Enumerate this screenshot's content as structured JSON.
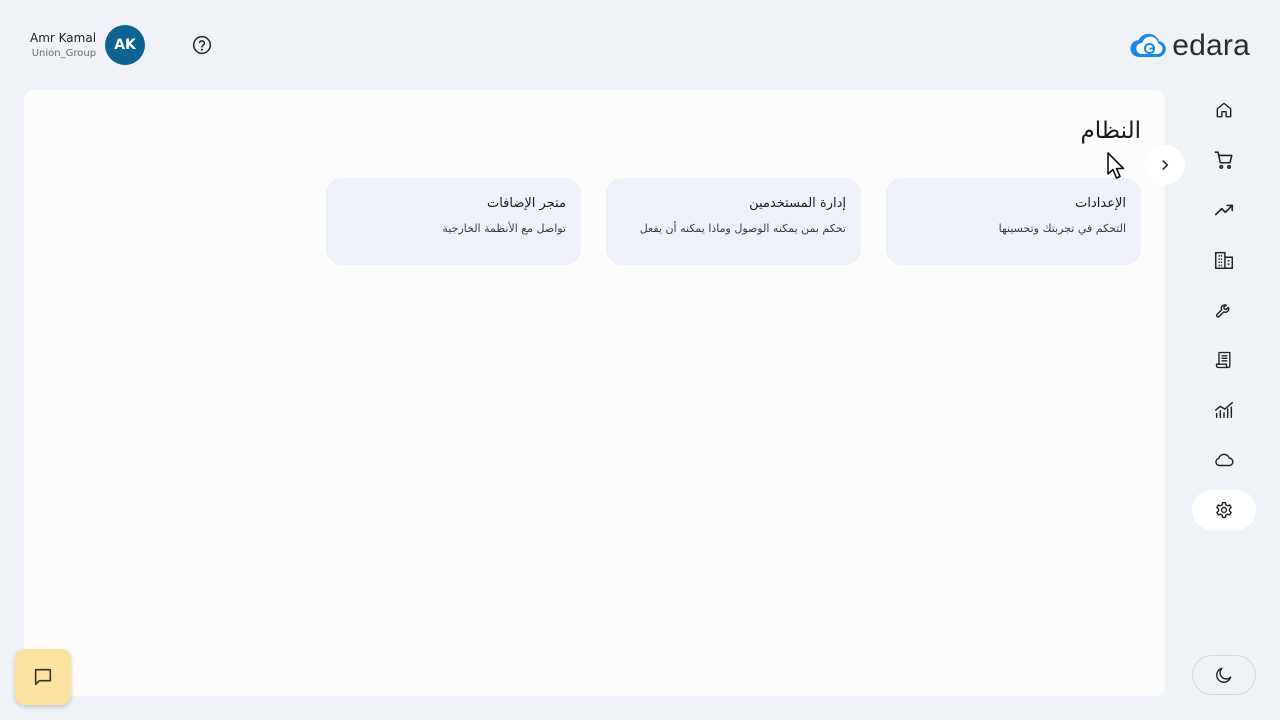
{
  "header": {
    "user_name": "Amr Kamal",
    "user_org": "Union_Group",
    "avatar_initials": "AK",
    "avatar_color": "#0e6390",
    "help_icon": "question-circle-icon",
    "logo_text": "edara",
    "logo_color": "#1e88e5"
  },
  "main": {
    "title": "النظام",
    "cards": [
      {
        "title": "الإعدادات",
        "description": "التحكم في تجربتك وتحسينها"
      },
      {
        "title": "إدارة المستخدمين",
        "description": "تحكم بمن يمكنه الوصول وماذا يمكنه أن يفعل"
      },
      {
        "title": "متجر الإضافات",
        "description": "تواصل مع الأنظمة الخارجية"
      }
    ]
  },
  "sidebar": {
    "items": [
      {
        "icon": "home-icon"
      },
      {
        "icon": "cart-icon"
      },
      {
        "icon": "trending-up-icon"
      },
      {
        "icon": "building-icon"
      },
      {
        "icon": "wrench-icon"
      },
      {
        "icon": "receipt-icon"
      },
      {
        "icon": "analytics-icon"
      },
      {
        "icon": "cloud-icon"
      },
      {
        "icon": "gear-icon",
        "active": true
      }
    ],
    "collapse_icon": "chevron-right-icon",
    "theme_icon": "moon-icon"
  },
  "chat": {
    "icon": "chat-icon",
    "background": "#fde3a1"
  },
  "colors": {
    "page_bg": "#eff3f8",
    "panel_bg": "#fcfcfc",
    "card_bg": "#eef2f8"
  }
}
